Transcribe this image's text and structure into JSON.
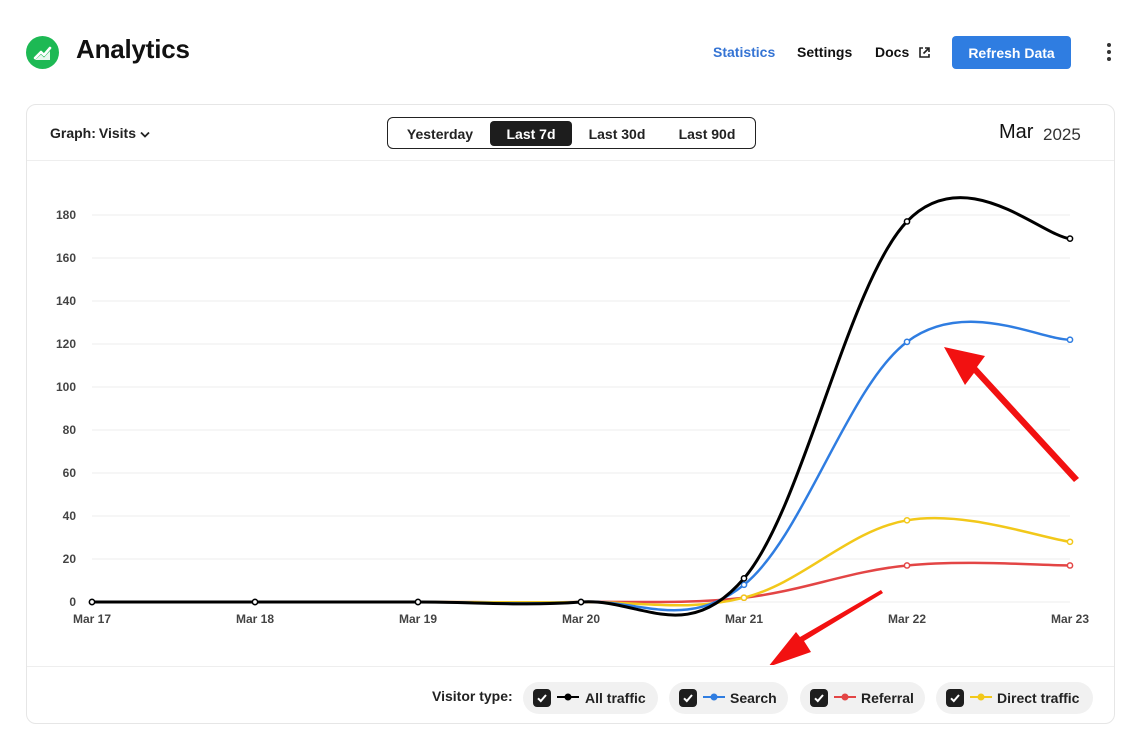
{
  "header": {
    "title": "Analytics",
    "logo_icon": "chart-logo-icon",
    "nav": [
      "Statistics",
      "Settings",
      "Docs"
    ],
    "active_nav": "Statistics",
    "refresh_label": "Refresh Data",
    "accent": "#2f7de1",
    "brand_color": "#1db954"
  },
  "toolbar": {
    "graph_label": "Graph:",
    "graph_value": "Visits",
    "ranges": [
      "Yesterday",
      "Last 7d",
      "Last 30d",
      "Last 90d"
    ],
    "active_range": "Last 7d",
    "month": "Mar",
    "year": "2025"
  },
  "legend": {
    "label": "Visitor type:",
    "items": [
      {
        "label": "All traffic",
        "color": "#000000",
        "checked": true
      },
      {
        "label": "Search",
        "color": "#2f7de1",
        "checked": true
      },
      {
        "label": "Referral",
        "color": "#e34545",
        "checked": true
      },
      {
        "label": "Direct traffic",
        "color": "#f2c81a",
        "checked": true
      }
    ]
  },
  "chart_data": {
    "type": "line",
    "x": [
      "Mar 17",
      "Mar 18",
      "Mar 19",
      "Mar 20",
      "Mar 21",
      "Mar 22",
      "Mar 23"
    ],
    "ylim": [
      0,
      180
    ],
    "yticks": [
      0,
      20,
      40,
      60,
      80,
      100,
      120,
      140,
      160,
      180
    ],
    "grid": true,
    "series": [
      {
        "name": "All traffic",
        "color": "#000000",
        "values": [
          0,
          0,
          0,
          0,
          11,
          177,
          169
        ]
      },
      {
        "name": "Search",
        "color": "#2f7de1",
        "values": [
          0,
          0,
          0,
          0,
          8,
          121,
          122
        ]
      },
      {
        "name": "Direct traffic",
        "color": "#f2c81a",
        "values": [
          0,
          0,
          0,
          0,
          2,
          38,
          28
        ]
      },
      {
        "name": "Referral",
        "color": "#e34545",
        "values": [
          0,
          0,
          0,
          0,
          2,
          17,
          17
        ]
      }
    ]
  }
}
